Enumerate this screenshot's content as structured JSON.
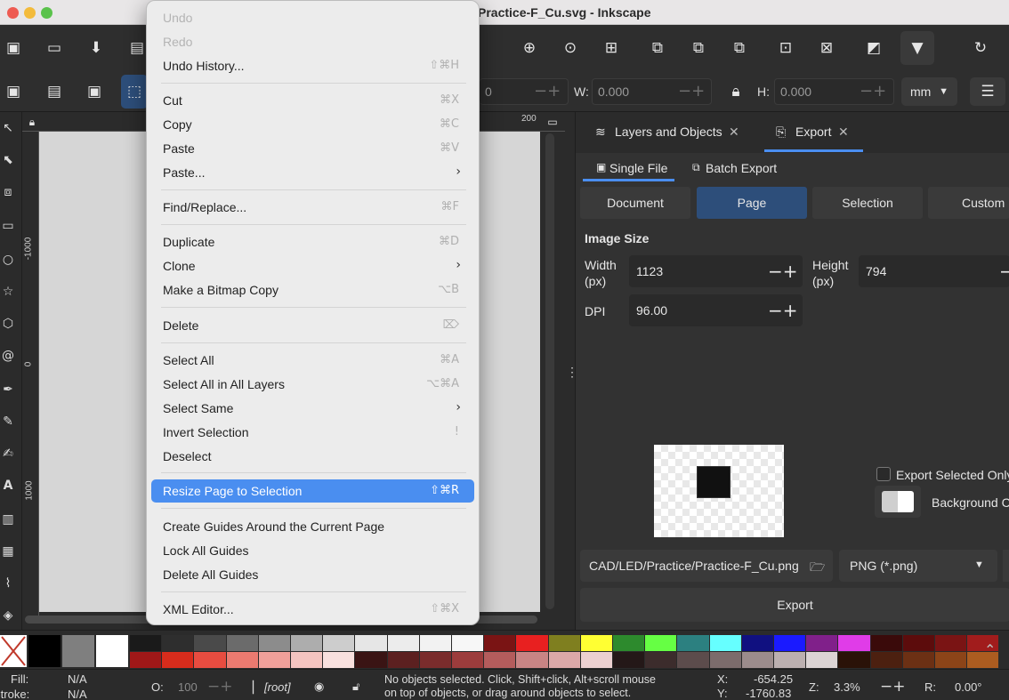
{
  "window": {
    "title": "Practice-F_Cu.svg - Inkscape"
  },
  "toolbar": {
    "w_label": "W:",
    "w_value": "0.000",
    "h_label": "H:",
    "h_value": "0.000",
    "x_value": "0",
    "units": "mm"
  },
  "rulers": {
    "h_mark": "200",
    "v_marks": [
      "-1000",
      "0",
      "1000"
    ]
  },
  "menu": {
    "undo": "Undo",
    "redo": "Redo",
    "undo_history": "Undo History...",
    "undo_history_sc": "⇧⌘H",
    "cut": "Cut",
    "cut_sc": "⌘X",
    "copy": "Copy",
    "copy_sc": "⌘C",
    "paste": "Paste",
    "paste_sc": "⌘V",
    "paste_more": "Paste...",
    "find_replace": "Find/Replace...",
    "find_replace_sc": "⌘F",
    "duplicate": "Duplicate",
    "duplicate_sc": "⌘D",
    "clone": "Clone",
    "make_bitmap": "Make a Bitmap Copy",
    "make_bitmap_sc": "⌥B",
    "delete": "Delete",
    "select_all": "Select All",
    "select_all_sc": "⌘A",
    "select_all_layers": "Select All in All Layers",
    "select_all_layers_sc": "⌥⌘A",
    "select_same": "Select Same",
    "invert_selection": "Invert Selection",
    "invert_selection_sc": "!",
    "deselect": "Deselect",
    "resize_page": "Resize Page to Selection",
    "resize_page_sc": "⇧⌘R",
    "create_guides": "Create Guides Around the Current Page",
    "lock_guides": "Lock All Guides",
    "delete_guides": "Delete All Guides",
    "xml_editor": "XML Editor...",
    "xml_editor_sc": "⇧⌘X"
  },
  "panel": {
    "tab_layers": "Layers and Objects",
    "tab_export": "Export",
    "single_file": "Single File",
    "batch_export": "Batch Export",
    "seg_document": "Document",
    "seg_page": "Page",
    "seg_selection": "Selection",
    "seg_custom": "Custom",
    "image_size": "Image Size",
    "width_label": "Width",
    "width_unit": "(px)",
    "width_value": "1123",
    "height_label": "Height",
    "height_unit": "(px)",
    "height_value": "794",
    "dpi_label": "DPI",
    "dpi_value": "96.00",
    "export_selected": "Export Selected Only",
    "background": "Background Color",
    "filename": "CAD/LED/Practice/Practice-F_Cu.png",
    "format": "PNG (*.png)",
    "export_button": "Export"
  },
  "status": {
    "fill_label": "Fill:",
    "fill_value": "N/A",
    "stroke_label": "Stroke:",
    "stroke_value": "N/A",
    "opacity_label": "O:",
    "opacity_value": "100",
    "layer": "[root]",
    "message_line1": "No objects selected. Click, Shift+click, Alt+scroll mouse",
    "message_line2": "on top of objects, or drag around objects to select.",
    "x_label": "X:",
    "x_value": "-654.25",
    "y_label": "Y:",
    "y_value": "-1760.83",
    "zoom_label": "Z:",
    "zoom_value": "3.3%",
    "rotation_label": "R:",
    "rotation_value": "0.00°"
  },
  "colors": {
    "accent": "#4a8ef0",
    "active_segment": "#2d4e7a",
    "menu_bg": "#ececec"
  },
  "palette": {
    "top_row": [
      "#1a1a1a",
      "#2e2e2e",
      "#4a4a4a",
      "#6b6b6b",
      "#8c8c8c",
      "#adadad",
      "#cdcdcd",
      "#e6e6e6",
      "#ececec",
      "#f2f2f2",
      "#f7f7f7",
      "#7a1414",
      "#e82020",
      "#7f7f1f",
      "#ffff33",
      "#2d8a2d",
      "#66ff44",
      "#2c8080",
      "#66ffff",
      "#101080",
      "#1a1aff",
      "#80208a",
      "#e03ce8",
      "#3a0a0a",
      "#5c0c0c",
      "#7a1414",
      "#a11c1c"
    ],
    "bottom_row": [
      "#a01818",
      "#d82c1c",
      "#e84c40",
      "#ec7a70",
      "#f0a09a",
      "#f4c4c0",
      "#f8e0de",
      "#3a1414",
      "#5c2020",
      "#7a2c2c",
      "#9c3c3c",
      "#b45c5c",
      "#c88484",
      "#dca8a8",
      "#ecd0d0",
      "#241818",
      "#3c2c2c",
      "#5c4c4c",
      "#7c6c6c",
      "#9c8c8c",
      "#bcb0b0",
      "#dcd4d4",
      "#2a1208",
      "#4c2010",
      "#6c3014",
      "#8c4418",
      "#ac5c20"
    ]
  }
}
